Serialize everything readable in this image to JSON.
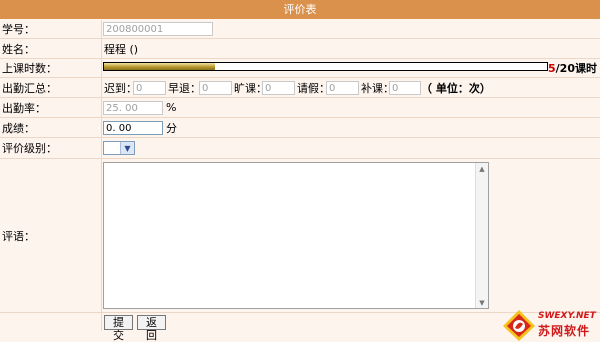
{
  "title": "评价表",
  "fields": {
    "student_id": {
      "label": "学号：",
      "value": "200800001"
    },
    "name": {
      "label": "姓名：",
      "value": "程程 ()"
    },
    "class_hours": {
      "label": "上课时数：",
      "progress_fraction": 0.25,
      "current": "5",
      "total_text": "/20课时"
    },
    "attendance_summary": {
      "label": "出勤汇总：",
      "late_label": "迟到：",
      "late_value": "0",
      "early_leave_label": "早退：",
      "early_leave_value": "0",
      "absent_label": "旷课：",
      "absent_value": "0",
      "leave_label": "请假：",
      "leave_value": "0",
      "makeup_label": "补课：",
      "makeup_value": "0",
      "unit_note": "（ 单位：次）"
    },
    "attendance_rate": {
      "label": "出勤率：",
      "value": "25. 00",
      "unit": "%"
    },
    "score": {
      "label": "成绩：",
      "value": "0. 00",
      "unit": "分"
    },
    "rating_level": {
      "label": "评价级别：",
      "selected": ""
    },
    "comment": {
      "label": "评语：",
      "value": ""
    }
  },
  "buttons": {
    "submit": "提交",
    "back": "返回"
  },
  "watermark": {
    "site": "SWEXY.NET",
    "name": "苏网软件"
  },
  "colors": {
    "title_bar": "#d9914c",
    "background": "#fdf4ee",
    "progress_current": "#cc0000"
  }
}
